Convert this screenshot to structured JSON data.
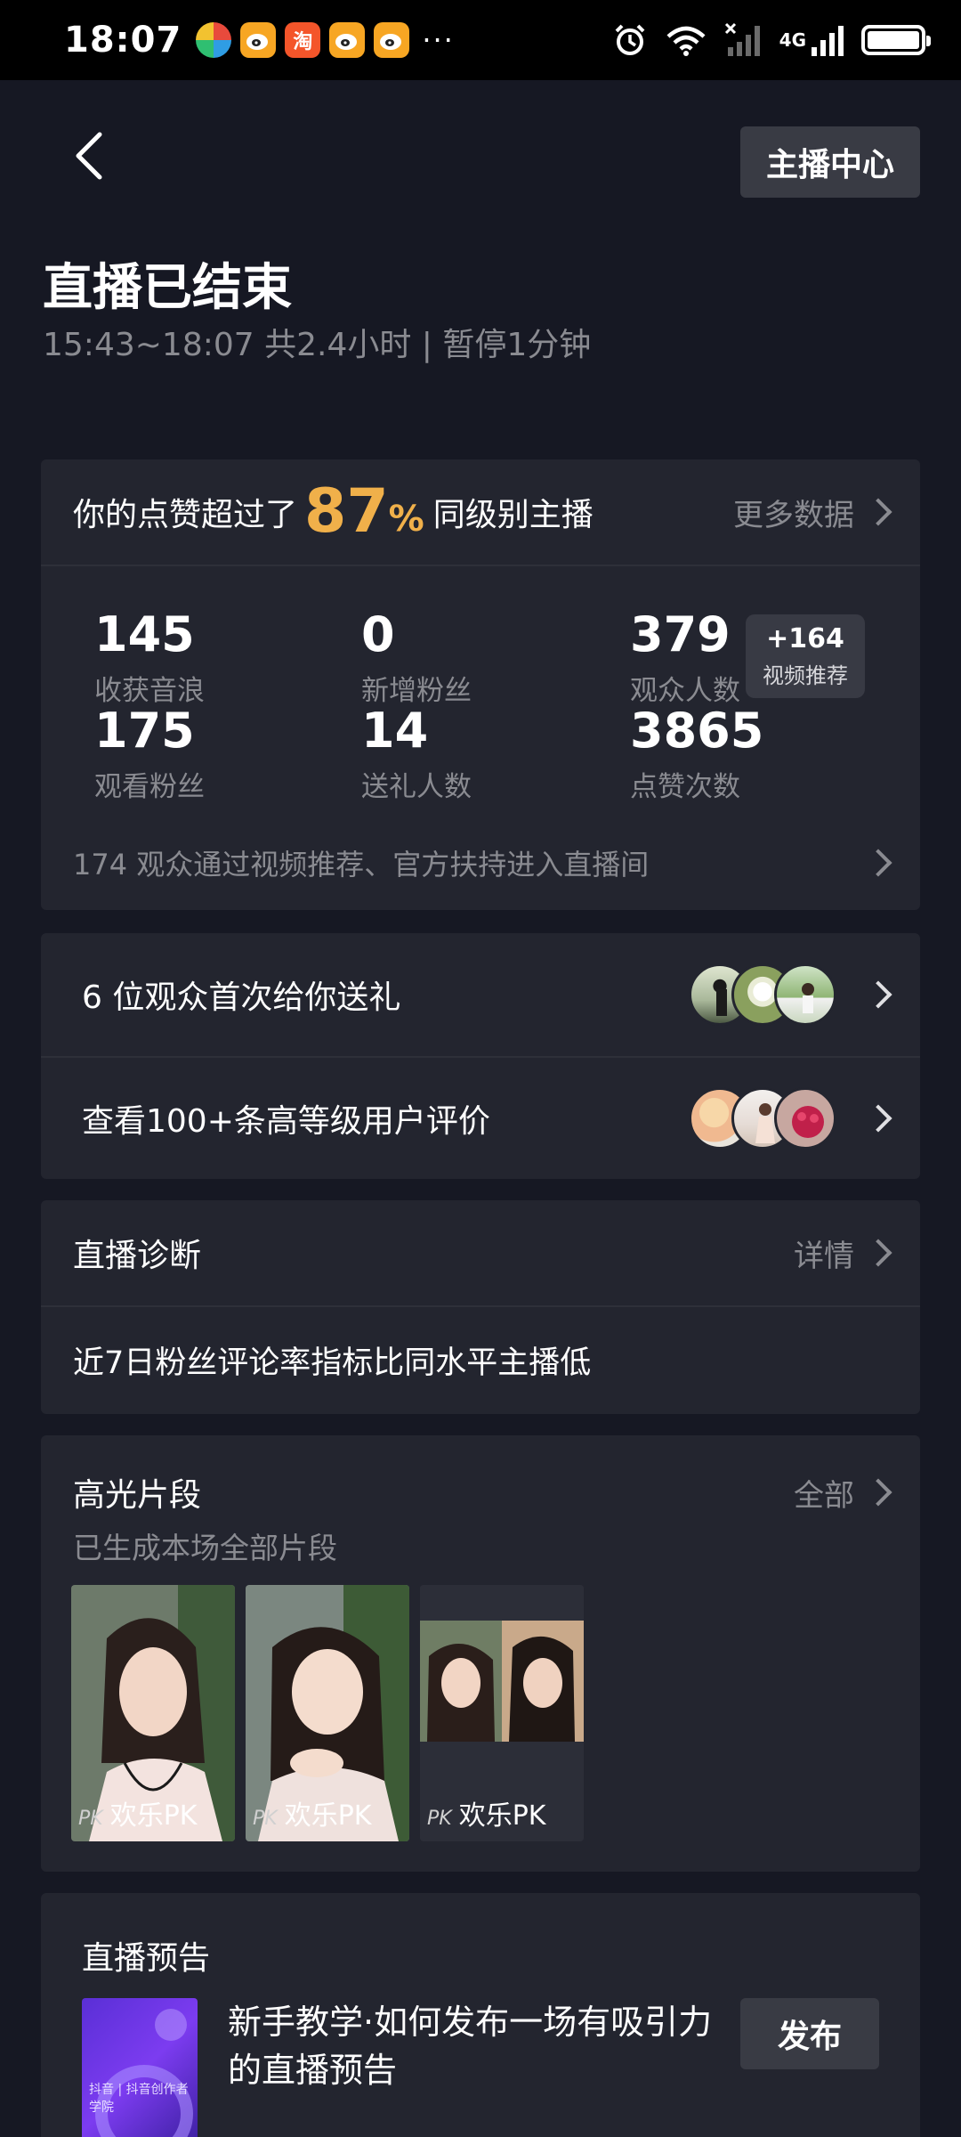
{
  "status_bar": {
    "time": "18:07",
    "notification_icons": [
      "app-icon",
      "weibo-icon",
      "taobao-icon",
      "weibo-icon",
      "weibo-icon"
    ],
    "taobao_glyph": "淘",
    "more": "···",
    "network": "4G"
  },
  "header": {
    "host_center_label": "主播中心",
    "title": "直播已结束",
    "subtitle": "15:43~18:07 共2.4小时 | 暂停1分钟"
  },
  "stats_card": {
    "prefix": "你的点赞超过了",
    "percent": "87",
    "percent_sign": "%",
    "suffix": "同级别主播",
    "more_data": "更多数据",
    "items": [
      {
        "value": "145",
        "label": "收获音浪"
      },
      {
        "value": "0",
        "label": "新增粉丝"
      },
      {
        "value": "379",
        "label": "观众人数"
      },
      {
        "value": "175",
        "label": "观看粉丝"
      },
      {
        "value": "14",
        "label": "送礼人数"
      },
      {
        "value": "3865",
        "label": "点赞次数"
      }
    ],
    "boost": {
      "value": "+164",
      "label": "视频推荐"
    },
    "footer": "174 观众通过视频推荐、官方扶持进入直播间"
  },
  "rows": {
    "first_gift": "6 位观众首次给你送礼",
    "reviews": "查看100+条高等级用户评价"
  },
  "diagnosis": {
    "title": "直播诊断",
    "details": "详情",
    "message": "近7日粉丝评论率指标比同水平主播低"
  },
  "highlights": {
    "title": "高光片段",
    "all": "全部",
    "subtitle": "已生成本场全部片段",
    "clips": [
      {
        "pk": "PK",
        "label": "欢乐PK"
      },
      {
        "pk": "PK",
        "label": "欢乐PK"
      },
      {
        "pk": "PK",
        "label": "欢乐PK"
      }
    ]
  },
  "preview": {
    "title": "直播预告",
    "thumb_caption": "抖音 | 抖音创作者学院",
    "text": "新手教学·如何发布一场有吸引力的直播预告",
    "publish": "发布"
  },
  "colors": {
    "background": "#161823",
    "card": "#23252f",
    "accent": "#f0b04a",
    "muted": "#8a8b91"
  }
}
